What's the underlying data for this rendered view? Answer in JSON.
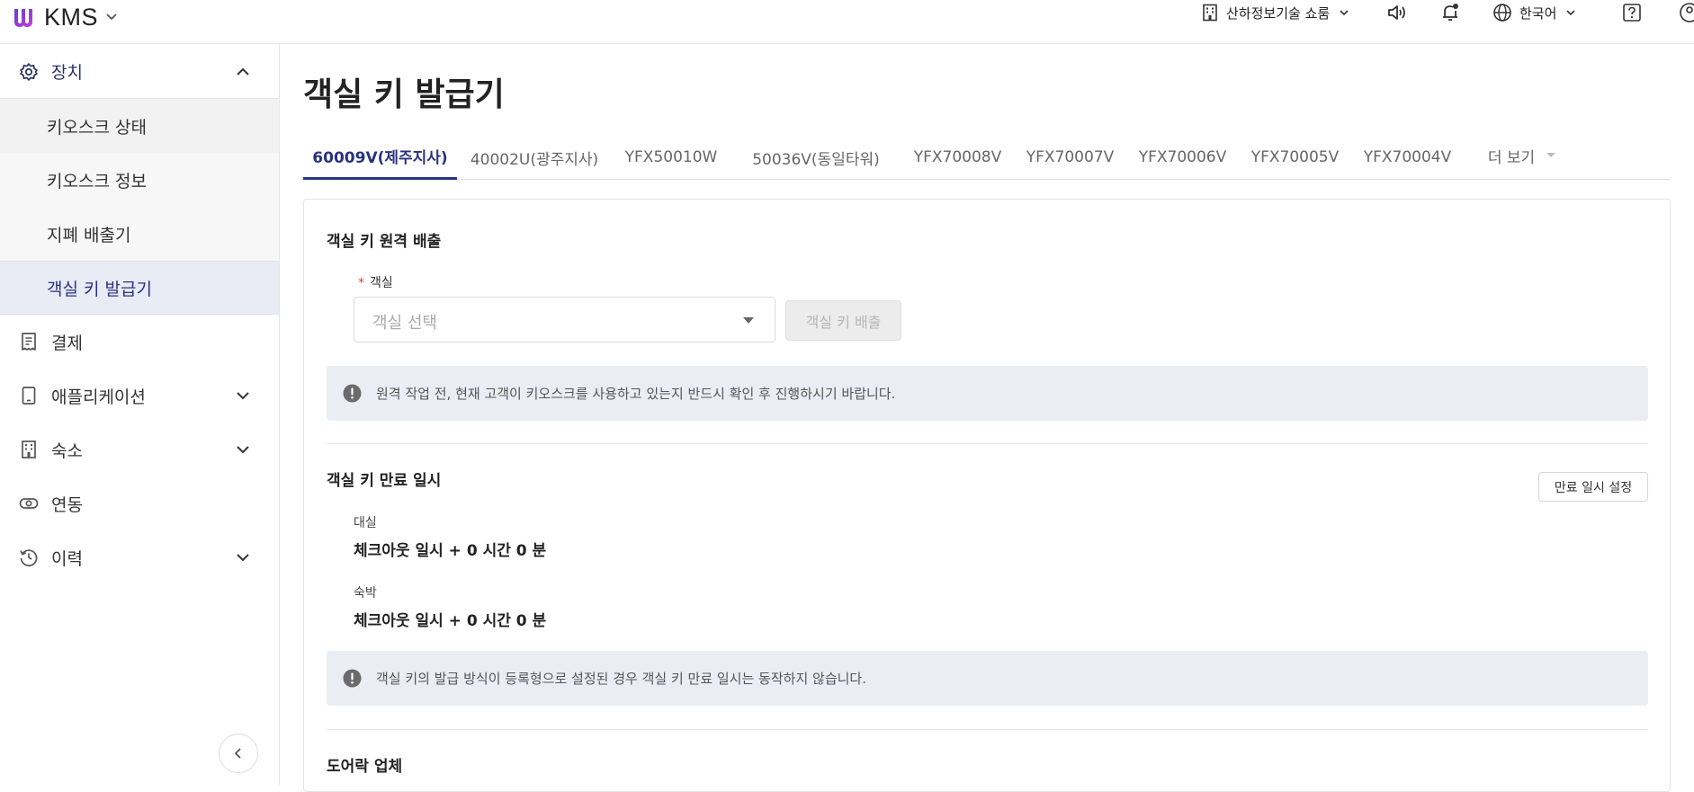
{
  "header": {
    "app_name": "KMS",
    "store_name": "산하정보기술 쇼룸",
    "language": "한국어"
  },
  "sidebar": {
    "device": "장치",
    "sub_items": [
      "키오스크 상태",
      "키오스크 정보",
      "지폐 배출기",
      "객실 키 발급기"
    ],
    "items": [
      "결제",
      "애플리케이션",
      "숙소",
      "연동",
      "이력"
    ]
  },
  "main": {
    "title": "객실 키 발급기",
    "tabs": [
      "60009V(제주지사)",
      "40002U(광주지사)",
      "YFX50010W",
      "50036V(동일타워)",
      "YFX70008V",
      "YFX70007V",
      "YFX70006V",
      "YFX70005V",
      "YFX70004V"
    ],
    "more_tab": "더 보기",
    "remote_section": {
      "title": "객실 키 원격 배출",
      "required_mark": "*",
      "room_label": "객실",
      "room_placeholder": "객실 선택",
      "eject_button": "객실 키 배출",
      "notice": "원격 작업 전, 현재 고객이 키오스크를 사용하고 있는지 반드시 확인 후 진행하시기 바랍니다."
    },
    "expiry_section": {
      "title": "객실 키 만료 일시",
      "set_button": "만료 일시 설정",
      "rental_label": "대실",
      "rental_value": "체크아웃 일시 + 0 시간 0 분",
      "stay_label": "숙박",
      "stay_value": "체크아웃 일시 + 0 시간 0 분",
      "notice": "객실 키의 발급 방식이 등록형으로 설정된 경우 객실 키 만료 일시는 동작하지 않습니다."
    },
    "doorlock_section": {
      "title": "도어락 업체"
    }
  },
  "colors": {
    "brand_purple": "#7b3fe4",
    "active_nav": "#29337e",
    "active_bg": "#e9ebf5",
    "notice_bg": "#ebedf5",
    "required": "#e0413b"
  },
  "icons": {
    "logo": "brand-logo-icon",
    "store": "building-icon",
    "sound": "speaker-icon",
    "bell": "bell-icon",
    "lang": "globe-icon",
    "help": "help-icon",
    "user": "user-icon",
    "device": "gear-icon",
    "pay": "receipt-icon",
    "app": "tablet-icon",
    "stay": "building-icon",
    "link": "toggle-icon",
    "history": "history-icon"
  }
}
